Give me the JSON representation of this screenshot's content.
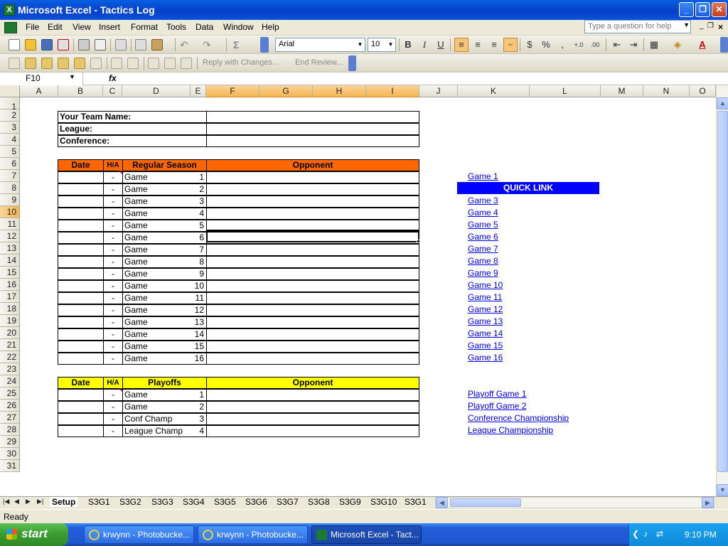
{
  "window": {
    "title": "Microsoft Excel - Tactics Log",
    "min_label": "_",
    "max_label": "❐",
    "close_label": "✕"
  },
  "menu": {
    "items": [
      "File",
      "Edit",
      "View",
      "Insert",
      "Format",
      "Tools",
      "Data",
      "Window",
      "Help"
    ],
    "help_placeholder": "Type a question for help"
  },
  "format_toolbar": {
    "font": "Arial",
    "size": "10",
    "bold": "B",
    "italic": "I",
    "underline": "U",
    "currency": "$",
    "percent": "%",
    "comma": ","
  },
  "review_toolbar": {
    "reply": "Reply with Changes...",
    "end_review": "End Review..."
  },
  "formula_bar": {
    "name_box": "F10",
    "fx": "fx",
    "content": ""
  },
  "columns": [
    "A",
    "B",
    "C",
    "D",
    "E",
    "F",
    "G",
    "H",
    "I",
    "J",
    "K",
    "L",
    "M",
    "N",
    "O"
  ],
  "selected_columns": [
    "F",
    "G",
    "H",
    "I"
  ],
  "rows": [
    "1",
    "2",
    "3",
    "4",
    "5",
    "6",
    "7",
    "8",
    "9",
    "10",
    "11",
    "12",
    "13",
    "14",
    "15",
    "16",
    "17",
    "18",
    "19",
    "20",
    "21",
    "22",
    "23",
    "24",
    "25",
    "26",
    "27",
    "28",
    "29",
    "30",
    "31"
  ],
  "selected_row": "10",
  "team_info": {
    "labels": [
      "Your Team Name:",
      "League:",
      "Conference:"
    ]
  },
  "regular_season": {
    "headers": {
      "date": "Date",
      "ha": "H/A",
      "season": "Regular Season",
      "opponent": "Opponent"
    },
    "ha_value": "-",
    "game_label": "Game",
    "numbers": [
      "1",
      "2",
      "3",
      "4",
      "5",
      "6",
      "7",
      "8",
      "9",
      "10",
      "11",
      "12",
      "13",
      "14",
      "15",
      "16"
    ]
  },
  "playoffs": {
    "headers": {
      "date": "Date",
      "ha": "H/A",
      "season": "Playoffs",
      "opponent": "Opponent"
    },
    "rows": [
      {
        "ha": "-",
        "label": "Game",
        "num": "1"
      },
      {
        "ha": "-",
        "label": "Game",
        "num": "2"
      },
      {
        "ha": "-",
        "label": "Conf Champ",
        "num": "3"
      },
      {
        "ha": "-",
        "label": "League Champ",
        "num": "4"
      }
    ]
  },
  "quick_link": {
    "title": "QUICK LINK",
    "games": [
      "Game 1",
      "Game 2",
      "Game 3",
      "Game 4",
      "Game 5",
      "Game 6",
      "Game 7",
      "Game 8",
      "Game 9",
      "Game 10",
      "Game 11",
      "Game 12",
      "Game 13",
      "Game 14",
      "Game 15",
      "Game 16"
    ],
    "playoffs": [
      "Playoff Game 1",
      "Playoff Game 2",
      "Conference Championship",
      "League Championship"
    ]
  },
  "sheet_tabs": {
    "active": "Setup",
    "others": [
      "S3G1",
      "S3G2",
      "S3G3",
      "S3G4",
      "S3G5",
      "S3G6",
      "S3G7",
      "S3G8",
      "S3G9",
      "S3G10",
      "S3G1"
    ]
  },
  "status": "Ready",
  "taskbar": {
    "start": "start",
    "tasks": [
      "krwynn - Photobucke...",
      "krwynn - Photobucke...",
      "Microsoft Excel - Tact..."
    ],
    "clock": "9:10 PM"
  },
  "colors": {
    "orange_header": "#ff6600",
    "yellow_header": "#ffff00",
    "quick_link_bg": "#0000ff",
    "link": "#0000ee"
  }
}
